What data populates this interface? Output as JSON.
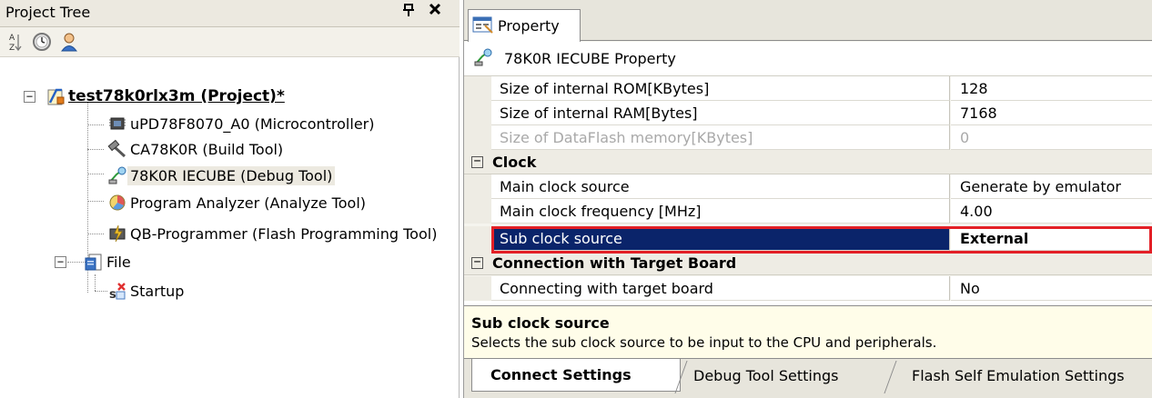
{
  "project_tree": {
    "title": "Project Tree",
    "pin_glyph": "ф",
    "close_glyph": "✕",
    "toolbar": [
      {
        "icon": "sort-icon"
      },
      {
        "icon": "clock-icon"
      },
      {
        "icon": "person-icon"
      }
    ],
    "nodes": {
      "project": {
        "label": "test78k0rlx3m (Project)*",
        "expander": "−",
        "icon": "project-icon"
      },
      "microcontroller": {
        "label": "uPD78F8070_A0 (Microcontroller)",
        "icon": "chip-icon"
      },
      "build": {
        "label": "CA78K0R (Build Tool)",
        "icon": "hammer-icon"
      },
      "debug": {
        "label": "78K0R IECUBE (Debug Tool)",
        "icon": "debug-probe-icon"
      },
      "analyze": {
        "label": "Program Analyzer (Analyze Tool)",
        "icon": "analyzer-icon"
      },
      "flash": {
        "label": "QB-Programmer (Flash Programming Tool)",
        "icon": "flash-programmer-icon"
      },
      "file": {
        "label": "File",
        "expander": "−",
        "icon": "folder-icon"
      },
      "startup": {
        "label": "Startup",
        "icon": "startup-file-icon"
      }
    }
  },
  "property_panel": {
    "tab_label": "Property",
    "header_label": "78K0R IECUBE Property",
    "rows": [
      {
        "name": "Size of internal ROM[KBytes]",
        "value": "128"
      },
      {
        "name": "Size of internal RAM[Bytes]",
        "value": "7168"
      },
      {
        "name": "Size of DataFlash memory[KBytes]",
        "value": "0",
        "disabled": true
      },
      {
        "category": "Clock",
        "collapse_glyph": "−"
      },
      {
        "name": "Main clock source",
        "value": "Generate by emulator"
      },
      {
        "name": "Main clock frequency [MHz]",
        "value": "4.00"
      },
      {
        "name": "Sub clock source",
        "value": "External",
        "selected": true
      },
      {
        "category": "Connection with Target Board",
        "collapse_glyph": "−"
      },
      {
        "name": "Connecting with target board",
        "value": "No"
      }
    ],
    "description": {
      "title": "Sub clock source",
      "text": "Selects the sub clock source to be input to the CPU and peripherals."
    },
    "bottom_tabs": [
      {
        "label": "Connect Settings",
        "active": true
      },
      {
        "label": "Debug Tool Settings",
        "active": false
      },
      {
        "label": "Flash Self Emulation Settings",
        "active": false
      }
    ]
  },
  "colors": {
    "selection": "#0a246a",
    "highlight_border": "#e31f26",
    "description_bg": "#fffde9"
  }
}
